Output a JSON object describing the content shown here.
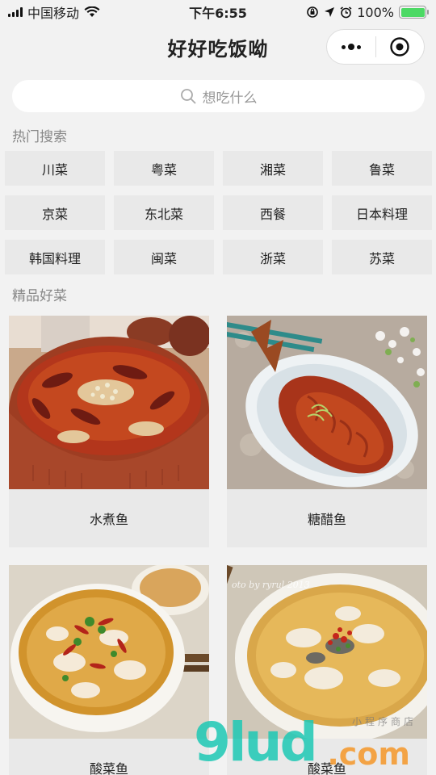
{
  "status_bar": {
    "carrier": "中国移动",
    "time": "下午6:55",
    "battery_percent": "100%",
    "battery_level": 1.0
  },
  "nav": {
    "title": "好好吃饭呦"
  },
  "search": {
    "placeholder": "想吃什么"
  },
  "hot_search": {
    "title": "热门搜索",
    "tags": [
      "川菜",
      "粤菜",
      "湘菜",
      "鲁菜",
      "京菜",
      "东北菜",
      "西餐",
      "日本料理",
      "韩国料理",
      "闽菜",
      "浙菜",
      "苏菜"
    ]
  },
  "featured": {
    "title": "精品好菜",
    "dishes": [
      {
        "name": "水煮鱼"
      },
      {
        "name": "糖醋鱼"
      },
      {
        "name": "酸菜鱼"
      },
      {
        "name": "酸菜鱼"
      }
    ]
  },
  "photo_caption": "oto by ryrul 2013",
  "watermark": {
    "main": "9lud",
    "suffix": ".com",
    "small": "小程序商店"
  },
  "colors": {
    "background": "#f2f2f2",
    "tag_bg": "#e9e9e9",
    "battery": "#4cd964",
    "watermark_teal": "#1cc8b4",
    "watermark_orange": "#f59628"
  }
}
